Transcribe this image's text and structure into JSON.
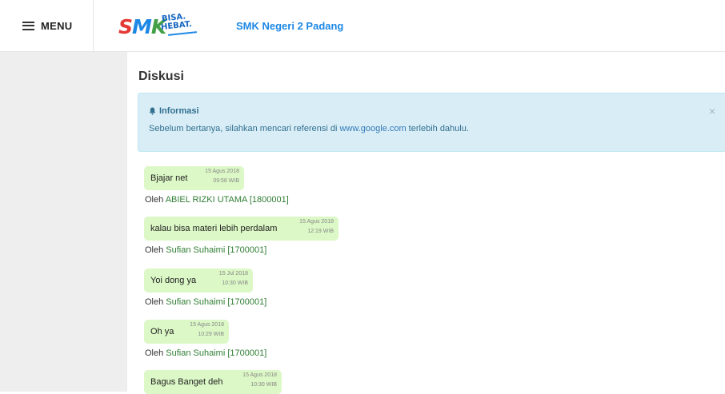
{
  "header": {
    "menu_label": "MENU",
    "logo_text": "SMK",
    "logo_sub1": "BISA.",
    "logo_sub2": "HEBAT.",
    "school_name": "SMK Negeri 2 Padang"
  },
  "main": {
    "title": "Diskusi",
    "alert": {
      "heading": "Informasi",
      "text_before": "Sebelum bertanya, silahkan mencari referensi di ",
      "link": "www.google.com",
      "text_after": " terlebih dahulu.",
      "close": "×"
    },
    "by_prefix": "Oleh ",
    "messages": [
      {
        "text": "Bjajar net",
        "date": "15 Agus 2018",
        "time": "09:58 WIB",
        "author": "ABIEL RIZKI UTAMA [1800001]"
      },
      {
        "text": "kalau bisa materi lebih perdalam",
        "date": "15 Agus 2018",
        "time": "12:19 WIB",
        "author": "Sufian Suhaimi [1700001]"
      },
      {
        "text": "Yoi dong ya",
        "date": "15 Jul 2018",
        "time": "10:30 WIB",
        "author": "Sufian Suhaimi [1700001]"
      },
      {
        "text": "Oh ya",
        "date": "15 Agus 2018",
        "time": "10:29 WIB",
        "author": "Sufian Suhaimi [1700001]"
      },
      {
        "text": "Bagus Banget deh",
        "date": "15 Agus 2018",
        "time": "10:30 WIB",
        "author": ""
      }
    ]
  }
}
